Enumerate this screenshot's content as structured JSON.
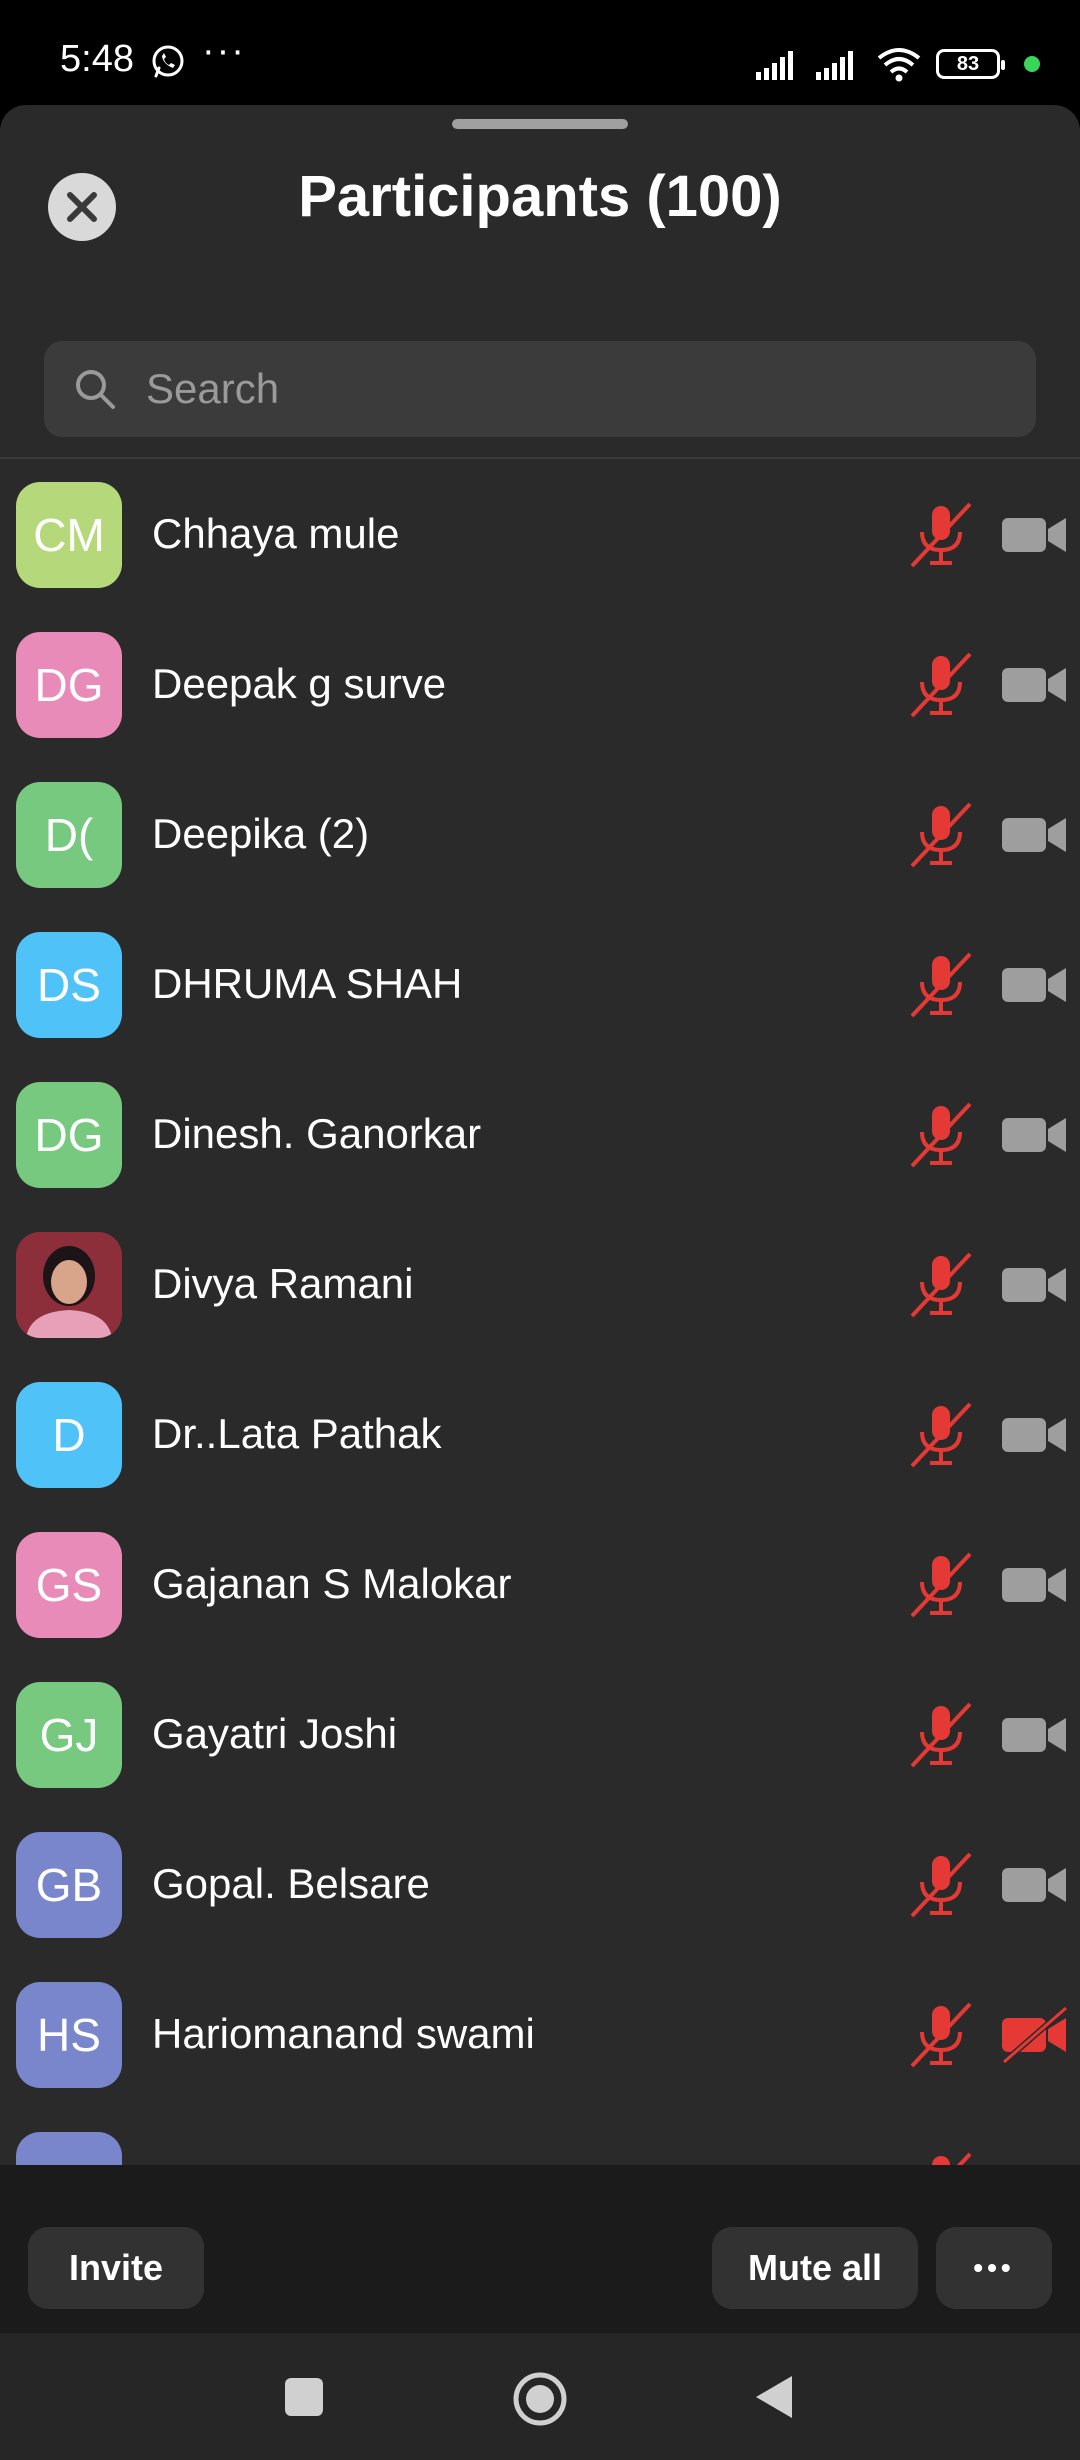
{
  "status_bar": {
    "time": "5:48",
    "battery": "83"
  },
  "header": {
    "title": "Participants (100)"
  },
  "search": {
    "placeholder": "Search"
  },
  "participants": [
    {
      "initials": "CM",
      "name": "Chhaya mule",
      "color": "#b5d97a",
      "mic": "muted",
      "video": "off"
    },
    {
      "initials": "DG",
      "name": "Deepak g surve",
      "color": "#e88bb8",
      "mic": "muted",
      "video": "off"
    },
    {
      "initials": "D(",
      "name": "Deepika (2)",
      "color": "#76c97f",
      "mic": "muted",
      "video": "off"
    },
    {
      "initials": "DS",
      "name": "DHRUMA SHAH",
      "color": "#4fc3f7",
      "mic": "muted",
      "video": "off"
    },
    {
      "initials": "DG",
      "name": "Dinesh. Ganorkar",
      "color": "#76c97f",
      "mic": "muted",
      "video": "off"
    },
    {
      "initials": "",
      "name": "Divya Ramani",
      "color": "#8d2f3a",
      "mic": "muted",
      "video": "off",
      "photo": true
    },
    {
      "initials": "D",
      "name": "Dr..Lata  Pathak",
      "color": "#4fc3f7",
      "mic": "muted",
      "video": "off"
    },
    {
      "initials": "GS",
      "name": "Gajanan S Malokar",
      "color": "#e88bb8",
      "mic": "muted",
      "video": "off"
    },
    {
      "initials": "GJ",
      "name": "Gayatri Joshi",
      "color": "#76c97f",
      "mic": "muted",
      "video": "off"
    },
    {
      "initials": "GB",
      "name": "Gopal. Belsare",
      "color": "#7986cb",
      "mic": "muted",
      "video": "off"
    },
    {
      "initials": "HS",
      "name": "Hariomanand swami",
      "color": "#7986cb",
      "mic": "muted",
      "video": "stopped"
    },
    {
      "initials": "",
      "name": "",
      "color": "#7986cb",
      "mic": "muted",
      "video": "off"
    }
  ],
  "footer": {
    "invite_label": "Invite",
    "mute_all_label": "Mute all",
    "more_label": "•••"
  },
  "colors": {
    "muted_red": "#e53935",
    "video_gray": "#9e9e9e",
    "sheet_bg": "#2a2a2a"
  }
}
